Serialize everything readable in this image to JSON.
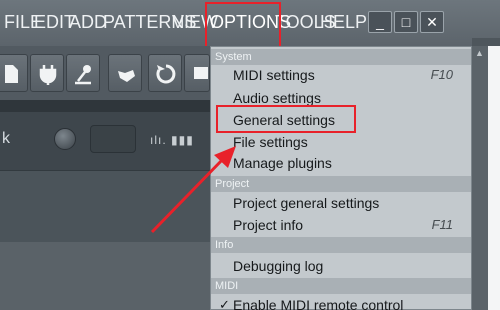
{
  "menubar": {
    "items": [
      "FILE",
      "EDIT",
      "ADD",
      "PATTERNS",
      "VIEW",
      "OPTIONS",
      "TOOLS",
      "HELP"
    ],
    "window_buttons": {
      "minimize": "_",
      "maximize": "□",
      "close": "✕"
    }
  },
  "left_panel": {
    "label": "k",
    "meter_text": "ılı. ▮▮▮"
  },
  "dropdown": {
    "sections": {
      "system": "System",
      "project": "Project",
      "info": "Info",
      "midi": "MIDI"
    },
    "items": {
      "midi_settings": "MIDI settings",
      "midi_settings_shortcut": "F10",
      "audio_settings": "Audio settings",
      "general_settings": "General settings",
      "file_settings": "File settings",
      "manage_plugins": "Manage plugins",
      "project_general_settings": "Project general settings",
      "project_info": "Project info",
      "project_info_shortcut": "F11",
      "debugging_log": "Debugging log",
      "enable_midi_remote": "Enable MIDI remote control",
      "check": "✓"
    }
  },
  "colors": {
    "highlight": "#e8212a",
    "menu_bg": "#c3c9cd",
    "section_bg": "#a9b0b5"
  }
}
